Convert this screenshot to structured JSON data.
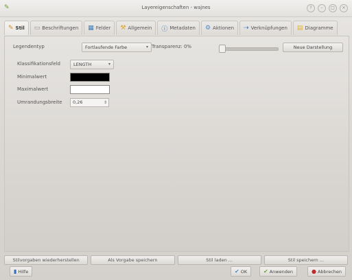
{
  "window": {
    "title": "Layereigenschaften - wajnes"
  },
  "tabs": [
    {
      "label": "Stil",
      "icon": "brush-icon",
      "color": "#d98a1b"
    },
    {
      "label": "Beschriftungen",
      "icon": "label-icon",
      "color": "#8a8a8a"
    },
    {
      "label": "Felder",
      "icon": "table-icon",
      "color": "#3f7fb8"
    },
    {
      "label": "Allgemein",
      "icon": "wrench-icon",
      "color": "#d6a22a"
    },
    {
      "label": "Metadaten",
      "icon": "info-icon",
      "color": "#2f6fc0"
    },
    {
      "label": "Aktionen",
      "icon": "gear-icon",
      "color": "#4a8ad0"
    },
    {
      "label": "Verknüpfungen",
      "icon": "join-icon",
      "color": "#2f6fc0"
    },
    {
      "label": "Diagramme",
      "icon": "chart-icon",
      "color": "#e0b43a"
    }
  ],
  "style": {
    "legend_type_label": "Legendentyp",
    "legend_type_value": "Fortlaufende Farbe",
    "transparency_label": "Transparenz: 0%",
    "transparency_percent": 0,
    "new_view_button": "Neue Darstellung",
    "classification_label": "Klassifikationsfeld",
    "classification_value": "LENGTH",
    "min_label": "Minimalwert",
    "min_color": "#000000",
    "max_label": "Maximalwert",
    "max_color": "#ffffff",
    "outline_label": "Umrandungsbreite",
    "outline_value": "0,26"
  },
  "bottom_buttons": [
    "Stilvorgaben wiederherstellen",
    "Als Vorgabe speichern",
    "Stil laden ...",
    "Stil speichern ..."
  ],
  "footer": {
    "help": "Hilfe",
    "ok": "OK",
    "apply": "Anwenden",
    "cancel": "Abbrechen"
  }
}
